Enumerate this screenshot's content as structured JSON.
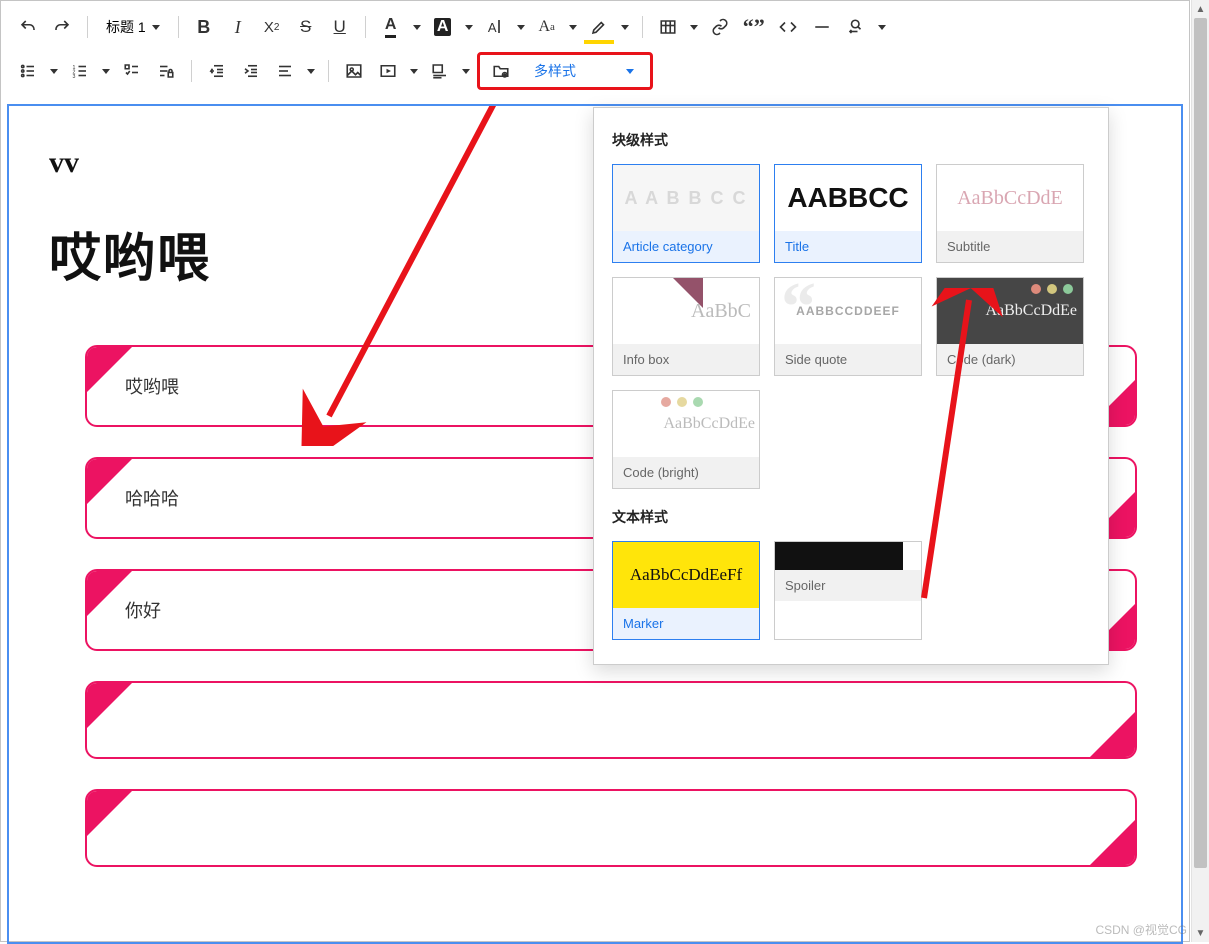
{
  "toolbar": {
    "heading_dropdown": "标题 1",
    "multi_style_label": "多样式"
  },
  "editor": {
    "subtitle": "vv",
    "title": "哎哟喂",
    "boxes": [
      "哎哟喂",
      "哈哈哈",
      "你好",
      "",
      ""
    ]
  },
  "popup": {
    "block_section": "块级样式",
    "text_section": "文本样式",
    "block_styles": [
      {
        "label": "Article category",
        "preview": "A A B B C C",
        "cls": "prev-artcat",
        "selected": true
      },
      {
        "label": "Title",
        "preview": "AABBCC",
        "cls": "prev-title",
        "selected": true
      },
      {
        "label": "Subtitle",
        "preview": "AaBbCcDdE",
        "cls": "prev-subtitle",
        "selected": false
      },
      {
        "label": "Info box",
        "preview": "AaBbC",
        "cls": "prev-infobox",
        "selected": false,
        "extra": "tri"
      },
      {
        "label": "Side quote",
        "preview": "AABBCCDDEEF",
        "cls": "prev-sidequote",
        "selected": false,
        "extra": "q"
      },
      {
        "label": "Code (dark)",
        "preview": "AaBbCcDdEe",
        "cls": "prev-codedark",
        "selected": false,
        "extra": "dots"
      },
      {
        "label": "Code (bright)",
        "preview": "AaBbCcDdEe",
        "cls": "prev-codebright",
        "selected": false,
        "extra": "dots"
      }
    ],
    "text_styles": [
      {
        "label": "Marker",
        "preview": "AaBbCcDdEeFf",
        "cls": "prev-marker",
        "selected": true
      },
      {
        "label": "Spoiler",
        "preview": "",
        "cls": "prev-spoiler",
        "selected": false
      }
    ]
  },
  "watermark": "CSDN @视觉CG",
  "colors": {
    "accent_pink": "#ec1362",
    "highlight_red": "#e8131a",
    "link_blue": "#1a73e8",
    "editor_border": "#4a8ef0"
  }
}
